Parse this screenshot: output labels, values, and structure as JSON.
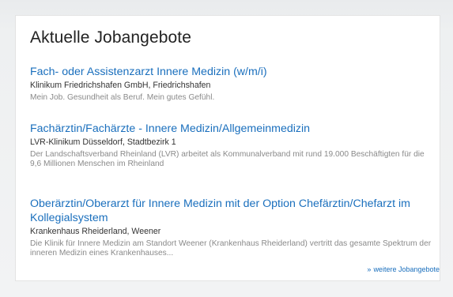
{
  "page": {
    "heading": "Aktuelle Jobangebote"
  },
  "jobs": [
    {
      "title": "Fach- oder Assistenzarzt Innere Medizin (w/m/i)",
      "company": "Klinikum Friedrichshafen GmbH, Friedrichshafen",
      "description": "Mein Job. Gesundheit als Beruf. Mein gutes Gefühl."
    },
    {
      "title": "Fachärztin/Fachärzte - Innere Medizin/Allgemeinmedizin",
      "company": "LVR-Klinikum Düsseldorf, Stadtbezirk 1",
      "description": "Der Landschaftsverband Rheinland (LVR) arbeitet als Kommunalverband mit rund 19.000 Beschäftigten für die 9,6 Millionen Menschen im Rheinland"
    },
    {
      "title": "Oberärztin/Oberarzt für Innere Medizin mit der Option Chefärztin/Chefarzt im Kollegialsystem",
      "company": "Krankenhaus Rheiderland, Weener",
      "description": "Die Klinik für Innere Medizin am Standort Weener (Krankenhaus Rheiderland) vertritt das gesamte Spektrum der inneren Medizin eines Krankenhauses..."
    }
  ],
  "footer": {
    "more_arrow": "»",
    "more_label": "weitere Jobangebote"
  },
  "colors": {
    "link": "#1a6fbd",
    "heading": "#222222",
    "company": "#333333",
    "description": "#8a8a8a"
  }
}
